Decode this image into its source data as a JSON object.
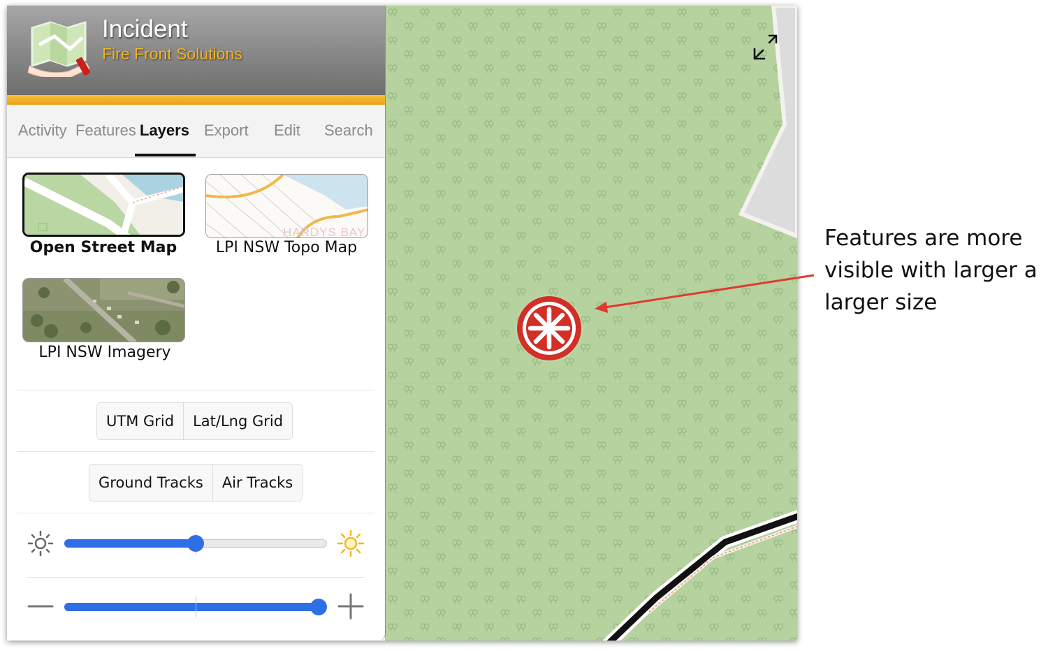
{
  "header": {
    "title": "Incident",
    "subtitle": "Fire Front Solutions",
    "logo_icon": "map-hand-icon"
  },
  "tabs": [
    {
      "label": "Activity",
      "active": false
    },
    {
      "label": "Features",
      "active": false
    },
    {
      "label": "Layers",
      "active": true
    },
    {
      "label": "Export",
      "active": false
    },
    {
      "label": "Edit",
      "active": false
    },
    {
      "label": "Search",
      "active": false
    }
  ],
  "layers": [
    {
      "label": "Open Street Map",
      "selected": true
    },
    {
      "label": "LPI NSW Topo Map",
      "selected": false,
      "thumb_text": "HARDYS BAY"
    },
    {
      "label": "LPI NSW Imagery",
      "selected": false
    }
  ],
  "grids": {
    "utm": "UTM Grid",
    "latlng": "Lat/Lng Grid"
  },
  "tracks": {
    "ground": "Ground Tracks",
    "air": "Air Tracks"
  },
  "controls": {
    "brightness": {
      "value": 0.5,
      "min_icon": "sun-dim-icon",
      "max_icon": "sun-bright-icon"
    },
    "size": {
      "value": 1.0,
      "min_icon": "minus-icon",
      "max_icon": "plus-icon"
    }
  },
  "map": {
    "expand_icon": "expand-arrows-icon",
    "marker_icon": "fire-asterisk-icon"
  },
  "annotation": {
    "lines": [
      "Features are more",
      "visible with larger a",
      "larger size"
    ],
    "arrow_color": "#e03a2f"
  },
  "colors": {
    "accent_orange": "#f4b224",
    "map_green": "#b5d29f",
    "slider_blue": "#2f6fe6",
    "marker_red": "#d22f27"
  }
}
